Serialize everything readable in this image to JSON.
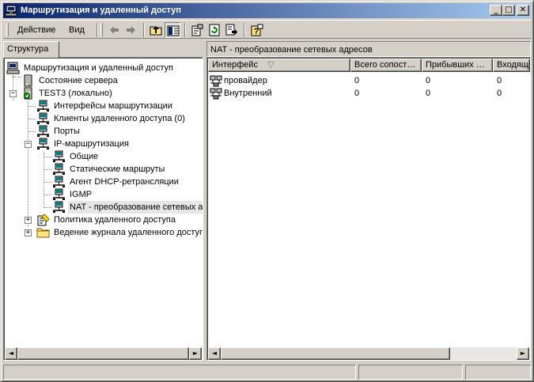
{
  "window": {
    "title": "Маршрутизация и удаленный доступ",
    "minimize_label": "_",
    "maximize_label": "□",
    "close_label": "✕"
  },
  "menu": {
    "action": "Действие",
    "view": "Вид"
  },
  "toolbar_icons": [
    "back-arrow-icon",
    "forward-arrow-icon",
    "up-folder-icon",
    "show-hide-tree-icon",
    "properties-icon",
    "refresh-icon",
    "export-list-icon",
    "help-icon"
  ],
  "left_tab": "Структура",
  "tree": {
    "root": "Маршрутизация и удаленный доступ",
    "server_status": "Состояние сервера",
    "server": "TEST3 (локально)",
    "routing_interfaces": "Интерфейсы маршрутизации",
    "remote_clients": "Клиенты удаленного доступа (0)",
    "ports": "Порты",
    "ip_routing": "IP-маршрутизация",
    "general": "Общие",
    "static_routes": "Статические маршруты",
    "dhcp_relay": "Агент DHCP-ретрансляции",
    "igmp": "IGMP",
    "nat": "NAT - преобразование сетевых адресов",
    "remote_policy": "Политика удаленного доступа",
    "remote_logging": "Ведение журнала удаленного доступа"
  },
  "right": {
    "header": "NAT - преобразование сетевых адресов",
    "columns": [
      "Интерфейс",
      "Всего сопост…",
      "Прибывших …",
      "Входящи"
    ],
    "sort_glyph": "▽",
    "rows": [
      {
        "name": "провайдер",
        "total": "0",
        "arrived": "0",
        "incoming": "0"
      },
      {
        "name": "Внутренний",
        "total": "0",
        "arrived": "0",
        "incoming": "0"
      }
    ]
  },
  "scroll": {
    "left_arrow": "◄",
    "right_arrow": "►"
  }
}
